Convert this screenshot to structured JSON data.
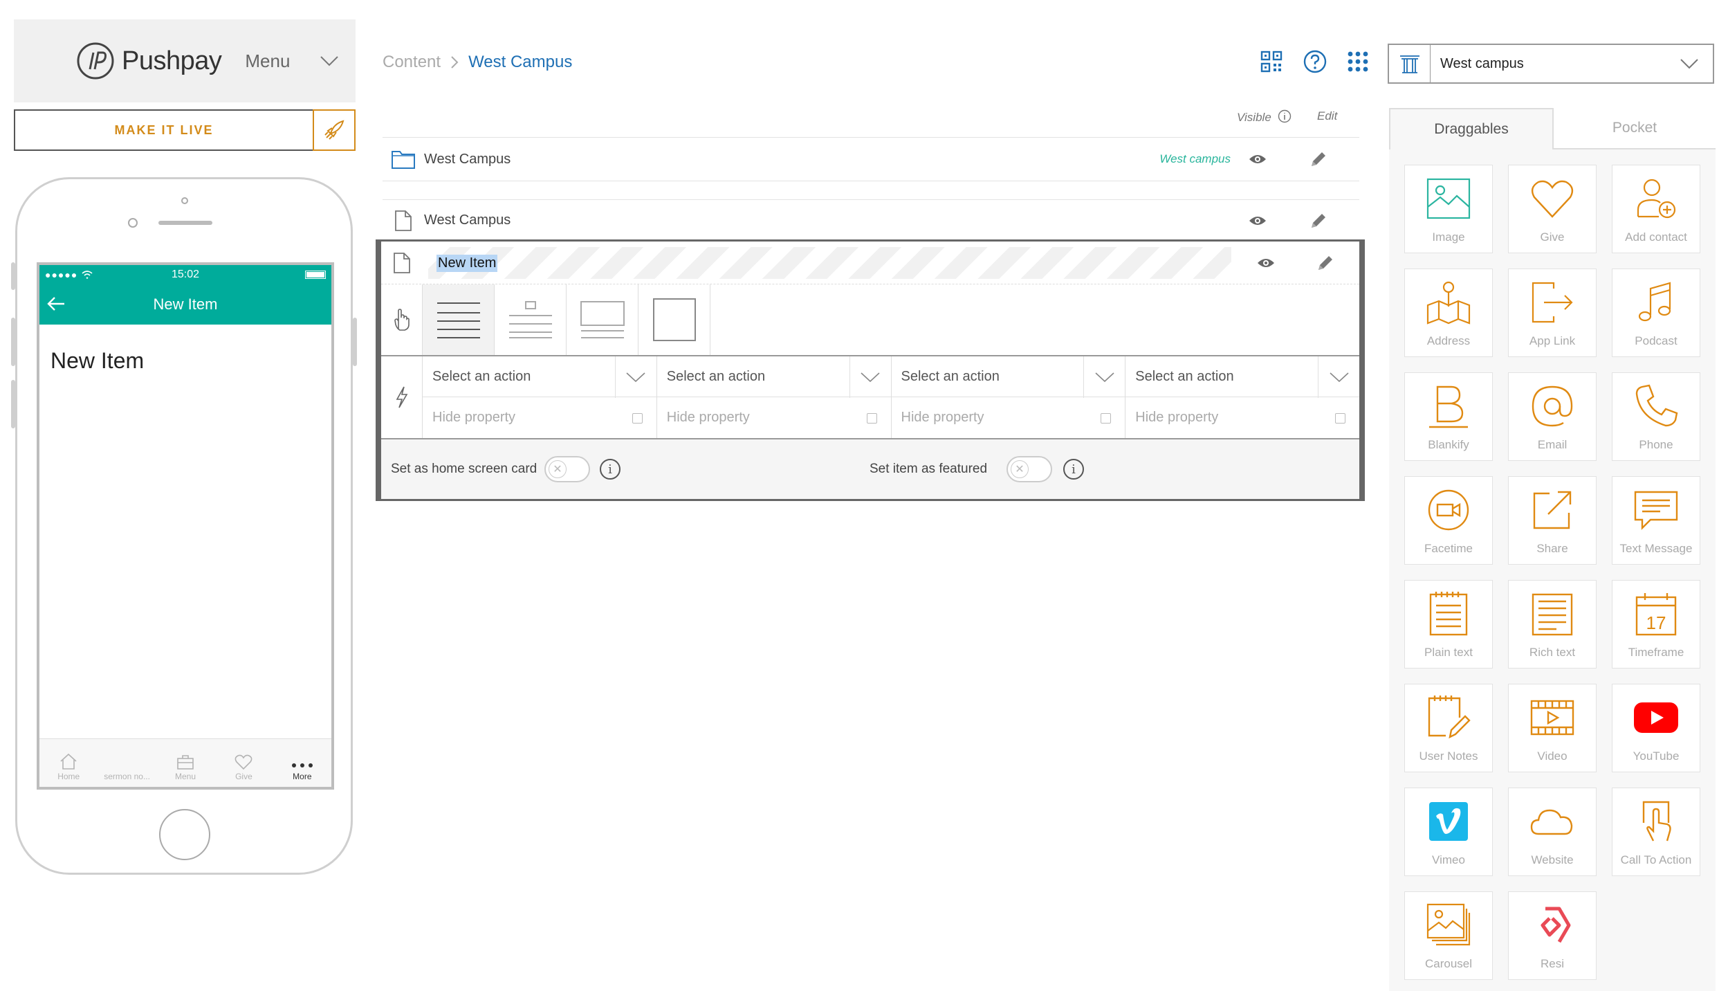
{
  "brand": {
    "name": "Pushpay",
    "menu_label": "Menu",
    "live_button": "MAKE IT LIVE"
  },
  "phone": {
    "signal": "●●●●●",
    "time": "15:02",
    "nav_title": "New Item",
    "heading": "New Item",
    "tabs": [
      {
        "label": "Home",
        "icon": "home-icon"
      },
      {
        "label": "sermon no...",
        "icon": ""
      },
      {
        "label": "Menu",
        "icon": "briefcase-icon"
      },
      {
        "label": "Give",
        "icon": "heart-icon"
      },
      {
        "label": "More",
        "icon": "more-icon"
      }
    ]
  },
  "breadcrumb": {
    "root": "Content",
    "separator": ">",
    "current": "West Campus"
  },
  "columns": {
    "visible": "Visible",
    "edit": "Edit"
  },
  "rows": [
    {
      "label": "West Campus",
      "tag": "West campus",
      "icon": "folder-icon"
    },
    {
      "label": "West Campus",
      "tag": "",
      "icon": "document-icon"
    }
  ],
  "editor": {
    "title": "New Item",
    "actions": [
      {
        "select": "Select an action",
        "hide": "Hide property"
      },
      {
        "select": "Select an action",
        "hide": "Hide property"
      },
      {
        "select": "Select an action",
        "hide": "Hide property"
      },
      {
        "select": "Select an action",
        "hide": "Hide property"
      }
    ],
    "home_card_label": "Set as home screen card",
    "featured_label": "Set item as featured",
    "toggle_glyph": "✕",
    "info_glyph": "i"
  },
  "campus": {
    "name": "West campus"
  },
  "panel": {
    "tabs": [
      "Draggables",
      "Pocket"
    ],
    "tiles": [
      "Image",
      "Give",
      "Add contact",
      "Address",
      "App Link",
      "Podcast",
      "Blankify",
      "Email",
      "Phone",
      "Facetime",
      "Share",
      "Text Message",
      "Plain text",
      "Rich text",
      "Timeframe",
      "User Notes",
      "Video",
      "YouTube",
      "Vimeo",
      "Website",
      "Call To Action",
      "Carousel",
      "Resi"
    ],
    "timeframe_day": "17"
  },
  "colors": {
    "accent": "#d38b1a",
    "teal": "#00ac9b",
    "link": "#1e6fb4",
    "green_tag": "#29b59c"
  }
}
